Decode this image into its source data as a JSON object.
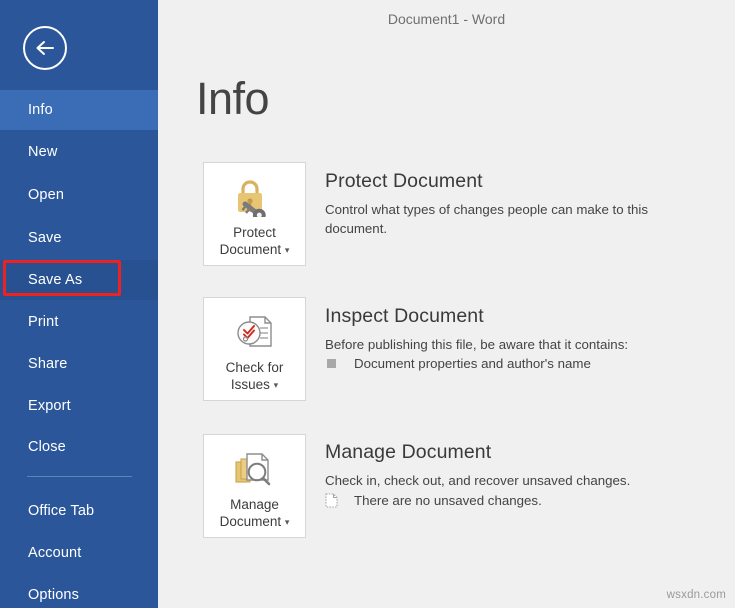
{
  "window": {
    "title": "Document1 - Word"
  },
  "sidebar": {
    "back_button_icon": "back-arrow-icon",
    "items": [
      {
        "label": "Info",
        "state": "active"
      },
      {
        "label": "New",
        "state": "normal"
      },
      {
        "label": "Open",
        "state": "normal"
      },
      {
        "label": "Save",
        "state": "normal"
      },
      {
        "label": "Save As",
        "state": "selected"
      },
      {
        "label": "Print",
        "state": "normal"
      },
      {
        "label": "Share",
        "state": "normal"
      },
      {
        "label": "Export",
        "state": "normal"
      },
      {
        "label": "Close",
        "state": "normal"
      },
      {
        "label": "Office Tab",
        "state": "normal"
      },
      {
        "label": "Account",
        "state": "normal"
      },
      {
        "label": "Options",
        "state": "normal"
      }
    ],
    "highlight_color": "#ee2222",
    "background_color": "#2b579a",
    "active_color": "#3a6db5",
    "selected_color": "#285191"
  },
  "page": {
    "title": "Info"
  },
  "sections": [
    {
      "button_label_line1": "Protect",
      "button_label_line2": "Document",
      "button_caret": "▾",
      "button_icon": "padlock-key-icon",
      "title": "Protect Document",
      "description": "Control what types of changes people can make to this document.",
      "bullets": []
    },
    {
      "button_label_line1": "Check for",
      "button_label_line2": "Issues",
      "button_caret": "▾",
      "button_icon": "document-check-icon",
      "title": "Inspect Document",
      "description": "Before publishing this file, be aware that it contains:",
      "bullets": [
        {
          "icon": "square-bullet-icon",
          "text": "Document properties and author's name"
        }
      ]
    },
    {
      "button_label_line1": "Manage",
      "button_label_line2": "Document",
      "button_caret": "▾",
      "button_icon": "documents-magnifier-icon",
      "title": "Manage Document",
      "description": "Check in, check out, and recover unsaved changes.",
      "bullets": [
        {
          "icon": "dotted-document-icon",
          "text": "There are no unsaved changes."
        }
      ]
    }
  ],
  "watermark": {
    "text": "wsxdn.com"
  }
}
